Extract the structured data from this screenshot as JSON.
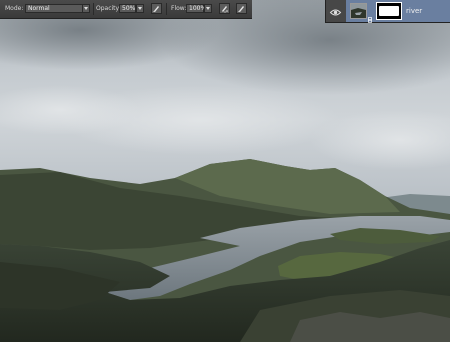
{
  "options_bar": {
    "mode_label": "Mode:",
    "mode_value": "Normal",
    "opacity_label": "Opacity:",
    "opacity_value": "50%",
    "flow_label": "Flow:",
    "flow_value": "100%",
    "airbrush_icon": "airbrush-icon",
    "pressure_icon": "tablet-pressure-icon"
  },
  "layers_panel": {
    "visibility_icon": "eye-icon",
    "layer_name": "river",
    "selected_color": "#6a7fa0"
  },
  "canvas": {
    "description_colors": {
      "sky": "#c9cfd3",
      "mountain": "#4c5a43",
      "water": "#8a949c"
    }
  }
}
